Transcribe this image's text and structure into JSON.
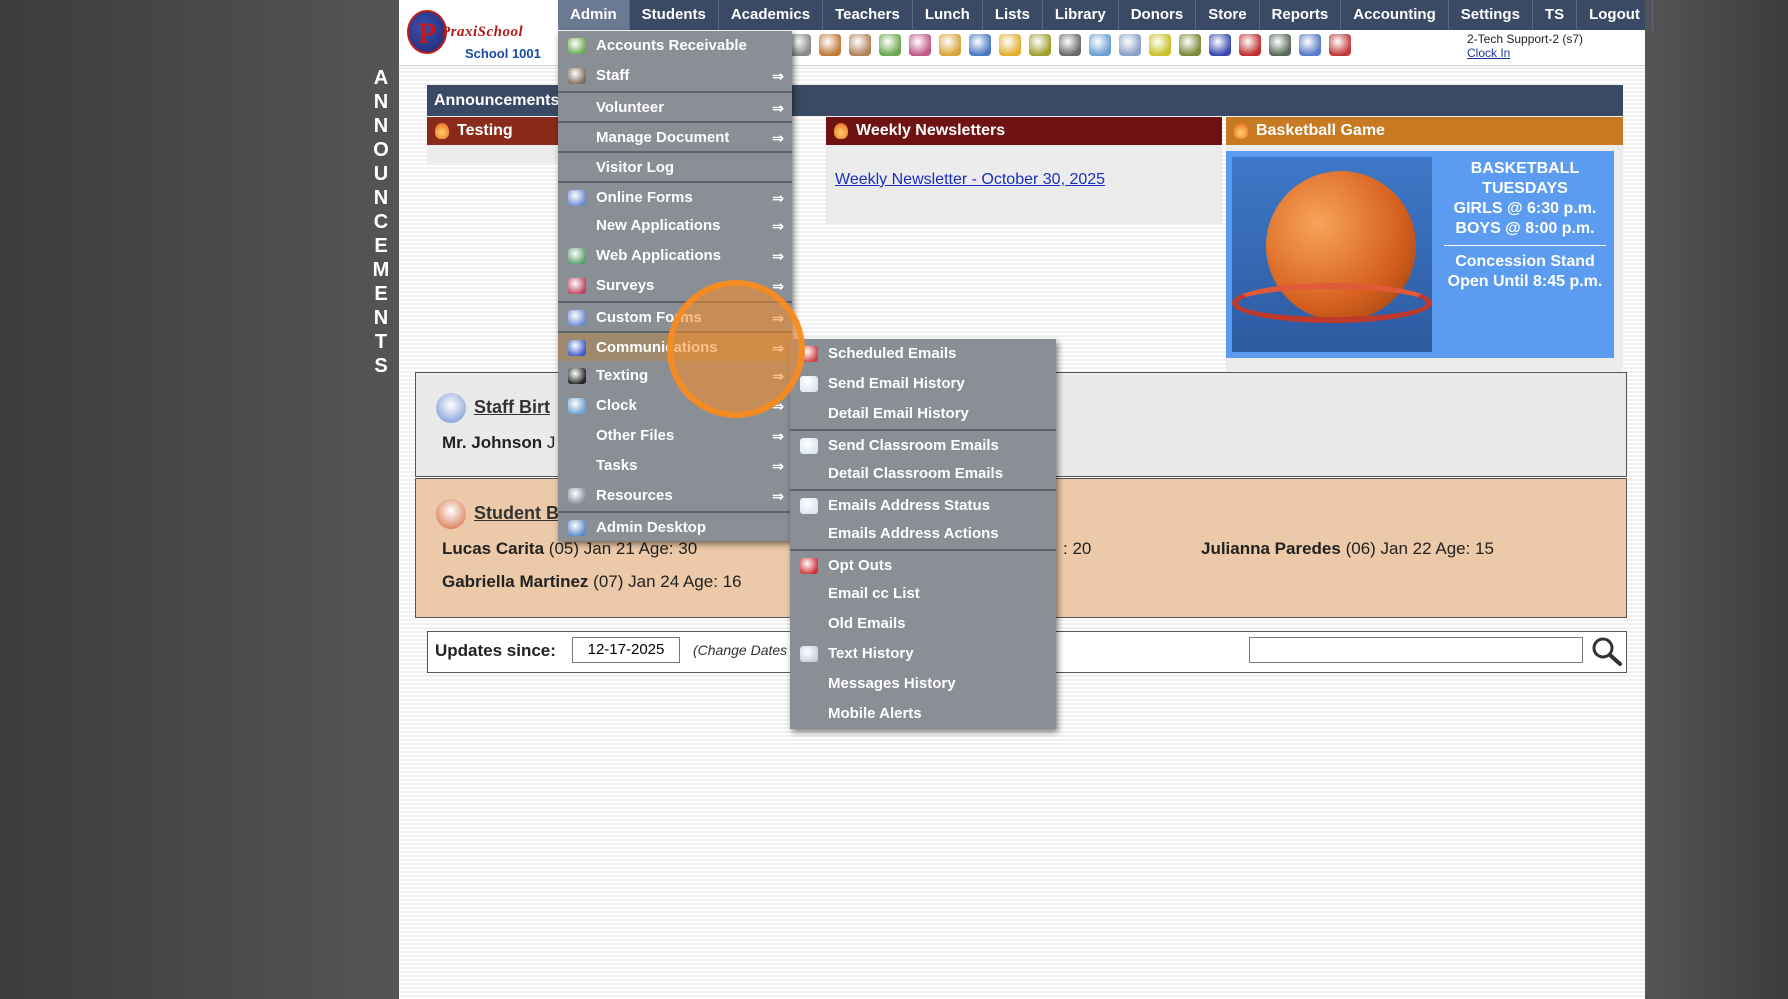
{
  "sidebar_word": [
    "A",
    "N",
    "N",
    "O",
    "U",
    "N",
    "C",
    "E",
    "M",
    "E",
    "N",
    "T",
    "S"
  ],
  "logo": {
    "name": "PraxiSchool",
    "school": "School 1001"
  },
  "topnav": [
    {
      "label": "Admin",
      "active": true
    },
    {
      "label": "Students"
    },
    {
      "label": "Academics"
    },
    {
      "label": "Teachers"
    },
    {
      "label": "Lunch"
    },
    {
      "label": "Lists"
    },
    {
      "label": "Library"
    },
    {
      "label": "Donors"
    },
    {
      "label": "Store"
    },
    {
      "label": "Reports"
    },
    {
      "label": "Accounting"
    },
    {
      "label": "Settings"
    },
    {
      "label": "TS"
    },
    {
      "label": "Logout"
    }
  ],
  "toolbar_icons": [
    {
      "name": "megaphone-icon",
      "color": "#8a8a8a"
    },
    {
      "name": "student-icon",
      "color": "#c07a3a"
    },
    {
      "name": "teacher-icon",
      "color": "#b0845a"
    },
    {
      "name": "money-icon",
      "color": "#6aa84f"
    },
    {
      "name": "people-icon",
      "color": "#c05a8a"
    },
    {
      "name": "lunch-icon",
      "color": "#d6a43a"
    },
    {
      "name": "book-icon",
      "color": "#4a7ac0"
    },
    {
      "name": "announce-icon",
      "color": "#e0b030"
    },
    {
      "name": "arrow-icon",
      "color": "#a0a030"
    },
    {
      "name": "staff-icon",
      "color": "#6b6b6b"
    },
    {
      "name": "clock-icon",
      "color": "#6aa0d0"
    },
    {
      "name": "table-icon",
      "color": "#8aa0c8"
    },
    {
      "name": "card-icon",
      "color": "#c8c02a"
    },
    {
      "name": "print-icon",
      "color": "#7a8a3a"
    },
    {
      "name": "ap-icon",
      "color": "#3a4ab0"
    },
    {
      "name": "pdf-icon",
      "color": "#c03030"
    },
    {
      "name": "cash-icon",
      "color": "#5a6a5a"
    },
    {
      "name": "help-icon",
      "color": "#5a7ac8"
    },
    {
      "name": "power-icon",
      "color": "#c03a3a"
    }
  ],
  "user": {
    "name": "2-Tech Support-2 (s7)",
    "clock_in": "Clock In"
  },
  "announcements": {
    "bar_title": "Announcements",
    "col1_title": "Testing",
    "col2_title": "Weekly Newsletters",
    "col2_link": "Weekly Newsletter - October 30, 2025",
    "col3_title": "Basketball Game",
    "bball_lines": [
      "BASKETBALL",
      "TUESDAYS",
      "GIRLS @ 6:30 p.m.",
      "BOYS  @ 8:00 p.m."
    ],
    "bball_lines2": [
      "Concession Stand",
      "Open Until 8:45 p.m."
    ],
    "colors": {
      "bar": "#3b4a64",
      "col1": "#8a2a1a",
      "col2": "#6e1212",
      "col3": "#c87a22",
      "bball": "#5b9cf0"
    }
  },
  "staff_birthdays": {
    "title": "Staff Birt",
    "entry_name": "Mr. Johnson",
    "entry_rest": "J"
  },
  "student_birthdays": {
    "title": "Student B",
    "entries": [
      {
        "name": "Lucas Carita",
        "rest": "(05) Jan 21 Age: 30"
      },
      {
        "name": "",
        "rest": ": 20"
      },
      {
        "name": "Julianna Paredes",
        "rest": "(06) Jan 22 Age: 15"
      },
      {
        "name": "Gabriella Martinez",
        "rest": "(07) Jan 24 Age: 16"
      }
    ]
  },
  "updates": {
    "label": "Updates since:",
    "date": "12-17-2025",
    "change": "(Change Dates"
  },
  "admin_menu": [
    {
      "label": "Accounts Receivable",
      "icon": "money-icon",
      "color": "#6aa84f",
      "arrow": false,
      "sep": false
    },
    {
      "label": "Staff",
      "icon": "staff-icon",
      "color": "#7a6a5a",
      "arrow": true,
      "sep": false
    },
    {
      "label": "Volunteer",
      "icon": "",
      "arrow": true,
      "sep": true
    },
    {
      "label": "Manage Document",
      "icon": "",
      "arrow": true,
      "sep": true
    },
    {
      "label": "Visitor Log",
      "icon": "",
      "arrow": false,
      "sep": true
    },
    {
      "label": "Online Forms",
      "icon": "html-icon",
      "color": "#6a8ad0",
      "arrow": true,
      "sep": true
    },
    {
      "label": "New Applications",
      "icon": "",
      "arrow": true,
      "sep": false
    },
    {
      "label": "Web Applications",
      "icon": "globe-icon",
      "color": "#5aa06a",
      "arrow": true,
      "sep": false
    },
    {
      "label": "Surveys",
      "icon": "survey-icon",
      "color": "#c04060",
      "arrow": true,
      "sep": false
    },
    {
      "label": "Custom Forms",
      "icon": "html-icon",
      "color": "#6a8ad0",
      "arrow": true,
      "sep": true
    },
    {
      "label": "Communications",
      "icon": "at-icon",
      "color": "#3a5ac8",
      "arrow": true,
      "sep": true,
      "highlight": true
    },
    {
      "label": "Texting",
      "icon": "phone-icon",
      "color": "#222222",
      "arrow": true,
      "sep": false
    },
    {
      "label": "Clock",
      "icon": "clock-icon",
      "color": "#6aa0d0",
      "arrow": true,
      "sep": false
    },
    {
      "label": "Other Files",
      "icon": "",
      "arrow": true,
      "sep": false
    },
    {
      "label": "Tasks",
      "icon": "",
      "arrow": true,
      "sep": false
    },
    {
      "label": "Resources",
      "icon": "list-icon",
      "color": "#8a8a9a",
      "arrow": true,
      "sep": false
    },
    {
      "label": "Admin Desktop",
      "icon": "desktop-icon",
      "color": "#5a8ac8",
      "arrow": false,
      "sep": true
    }
  ],
  "comm_menu": [
    {
      "label": "Scheduled Emails",
      "icon": "calendar-icon",
      "color": "#d04040",
      "sep": false
    },
    {
      "label": "Send Email History",
      "icon": "envelope-icon",
      "color": "#dde6f4",
      "sep": false
    },
    {
      "label": "Detail Email History",
      "icon": "",
      "sep": false
    },
    {
      "label": "Send Classroom Emails",
      "icon": "envelope-icon",
      "color": "#dde6f4",
      "sep": true
    },
    {
      "label": "Detail Classroom Emails",
      "icon": "",
      "sep": false
    },
    {
      "label": "Emails Address Status",
      "icon": "envelope-icon",
      "color": "#dde6f4",
      "sep": true
    },
    {
      "label": "Emails Address Actions",
      "icon": "",
      "sep": false
    },
    {
      "label": "Opt Outs",
      "icon": "x-circle-icon",
      "color": "#d03030",
      "sep": true
    },
    {
      "label": "Email cc List",
      "icon": "",
      "sep": false
    },
    {
      "label": "Old Emails",
      "icon": "",
      "sep": false
    },
    {
      "label": "Text History",
      "icon": "phone-text-icon",
      "color": "#c8d0e0",
      "sep": false
    },
    {
      "label": "Messages History",
      "icon": "",
      "sep": false
    },
    {
      "label": "Mobile Alerts",
      "icon": "",
      "sep": false
    }
  ]
}
